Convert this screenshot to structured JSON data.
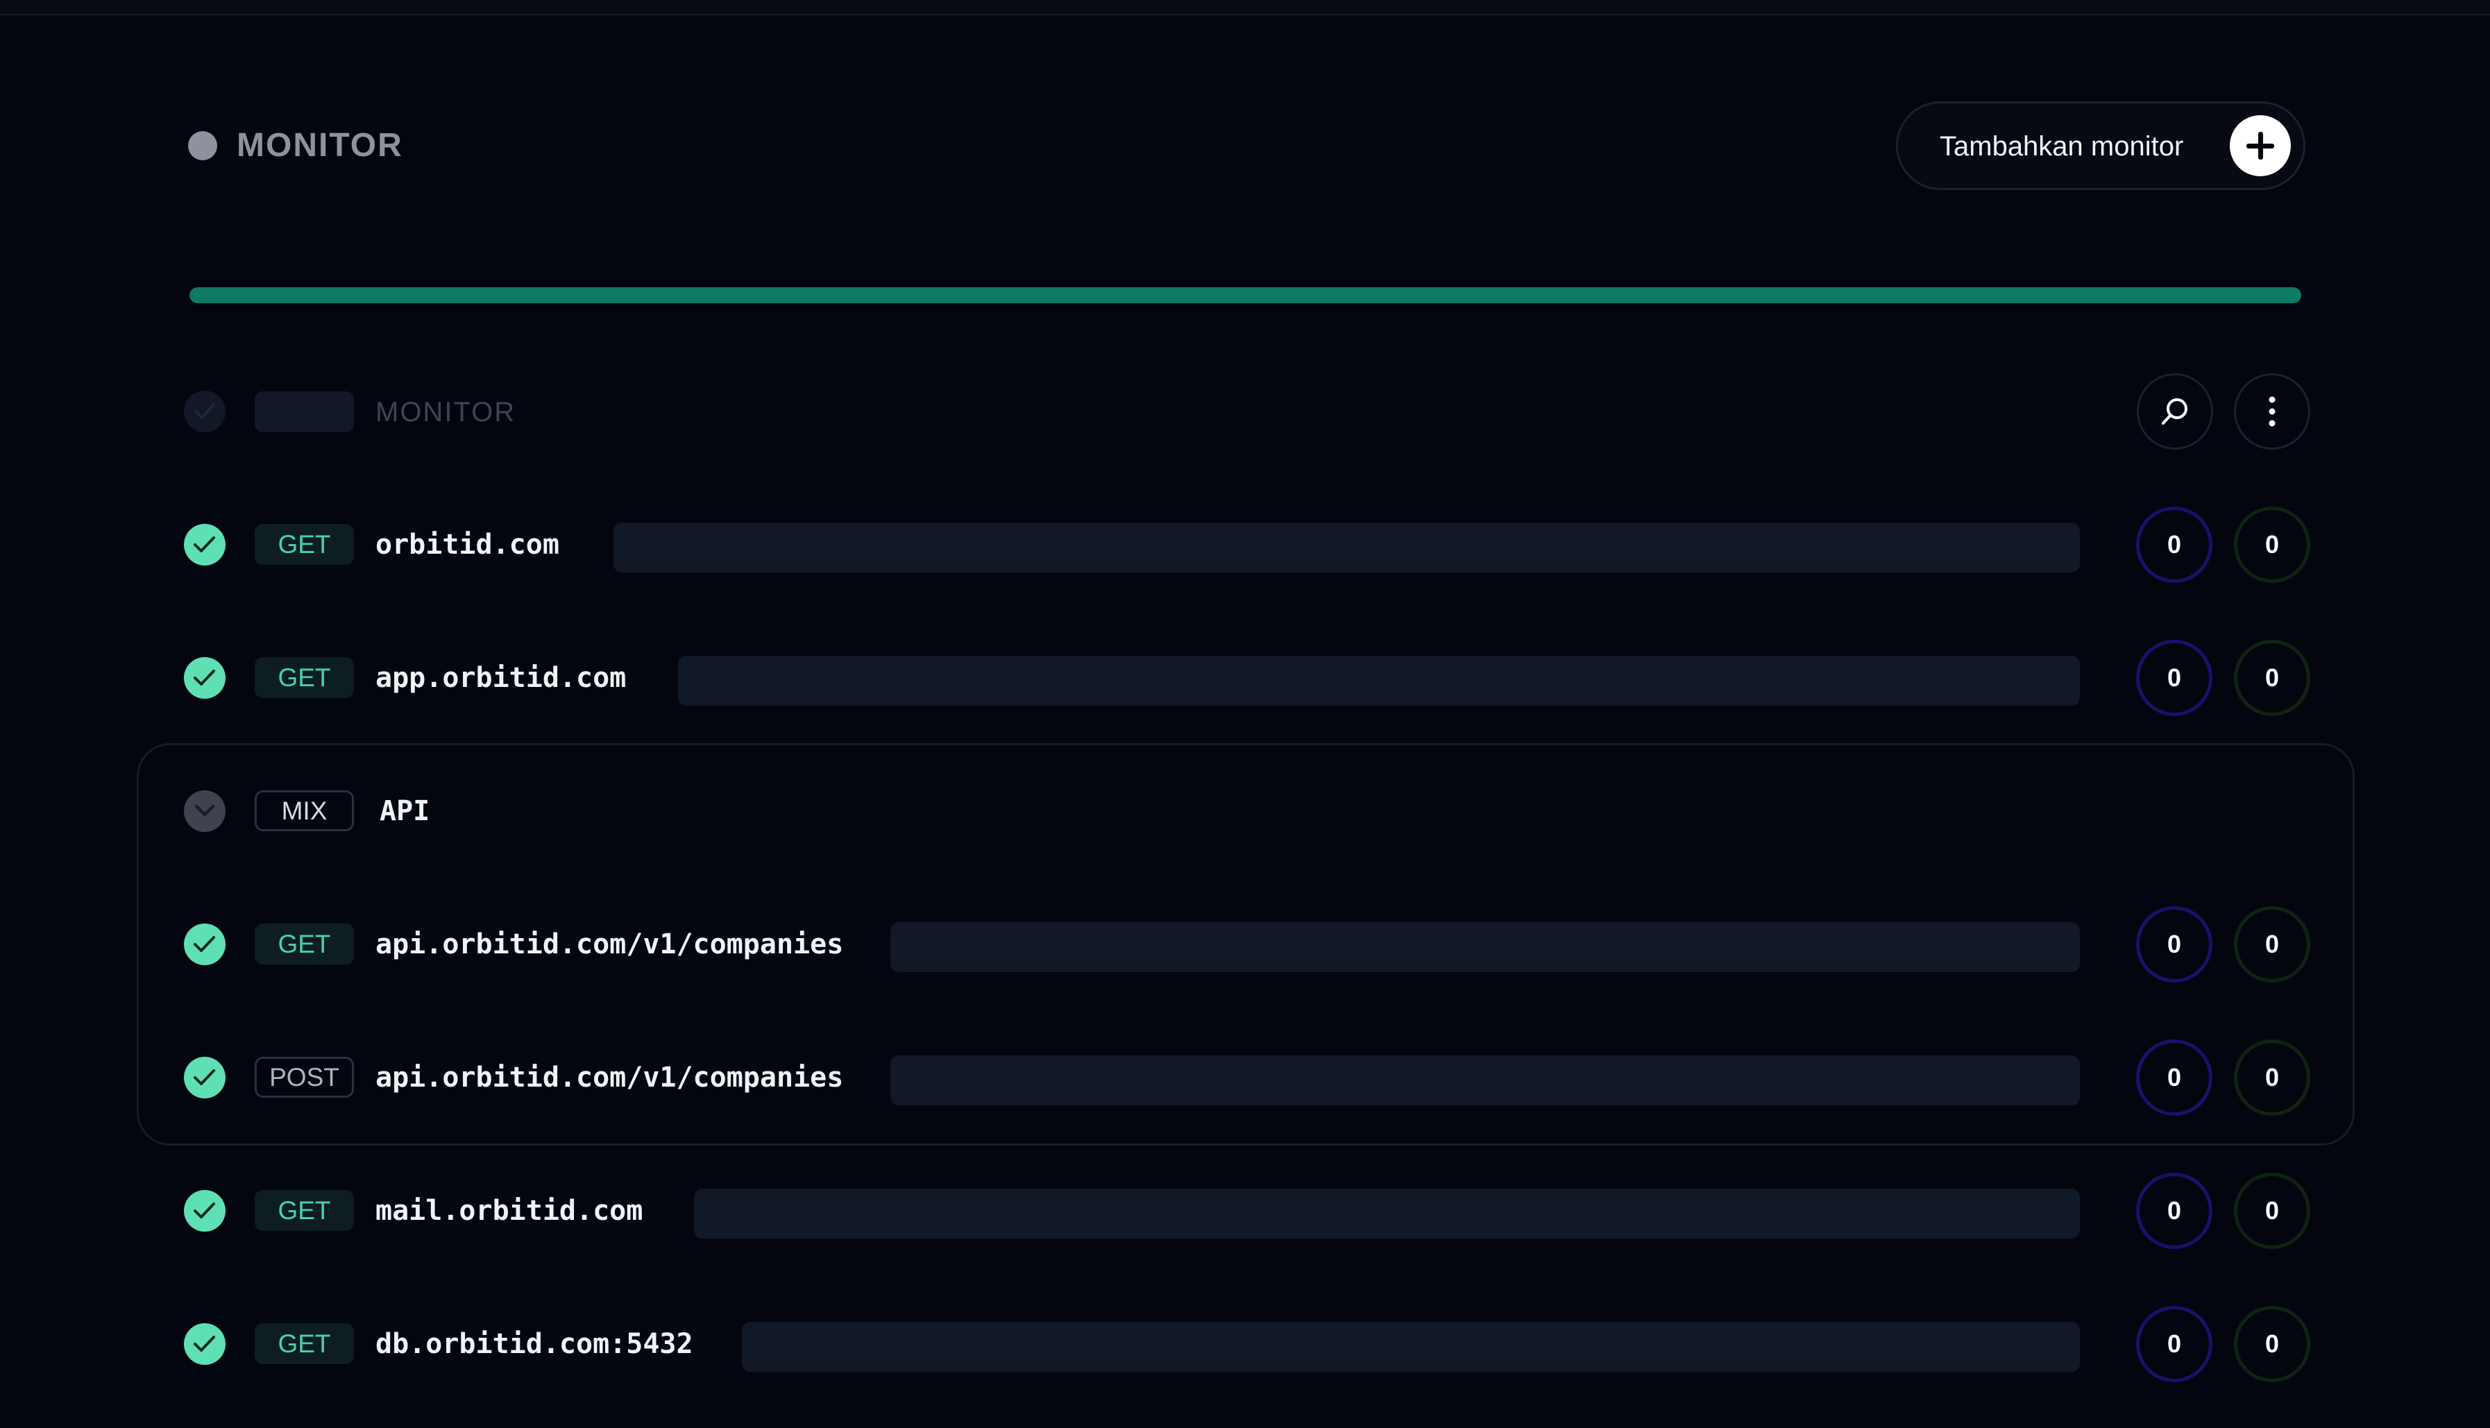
{
  "header": {
    "title": "MONITOR",
    "add_button_label": "Tambahkan monitor"
  },
  "uptime_progress": 1.0,
  "list_header": {
    "label": "MONITOR"
  },
  "monitors": [
    {
      "method": "GET",
      "url": "orbitid.com",
      "count_a": "0",
      "count_b": "0"
    },
    {
      "method": "GET",
      "url": "app.orbitid.com",
      "count_a": "0",
      "count_b": "0"
    },
    {
      "method": "GET",
      "url": "mail.orbitid.com",
      "count_a": "0",
      "count_b": "0"
    },
    {
      "method": "GET",
      "url": "db.orbitid.com:5432",
      "count_a": "0",
      "count_b": "0"
    }
  ],
  "group": {
    "method": "MIX",
    "name": "API",
    "items": [
      {
        "method": "GET",
        "url": "api.orbitid.com/v1/companies",
        "count_a": "0",
        "count_b": "0"
      },
      {
        "method": "POST",
        "url": "api.orbitid.com/v1/companies",
        "count_a": "0",
        "count_b": "0"
      }
    ]
  },
  "colors": {
    "background": "#03060f",
    "accent_green": "#0f7a62",
    "check_green": "#5ee0b4",
    "count_ring_a": "#16136a",
    "count_ring_b": "#102312"
  },
  "icons": {
    "add": "plus-icon",
    "search": "search-icon",
    "more": "more-vertical-icon",
    "status": "check-icon",
    "group": "chevron-down-icon"
  }
}
